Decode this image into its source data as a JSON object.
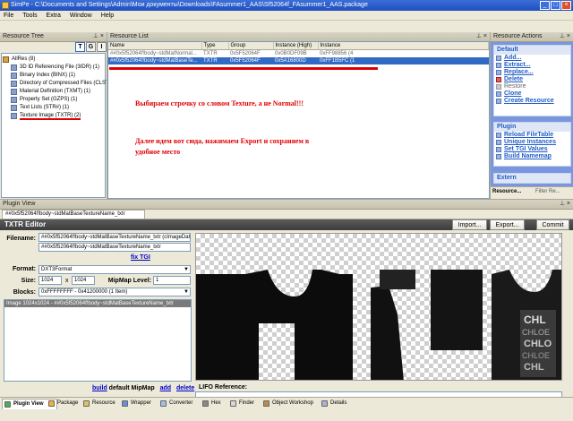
{
  "window": {
    "title": "SimPe - C:\\Documents and Settings\\Admin\\Мои документы\\Downloads\\FAsummer1_AAS\\Sf52064f_FAsummer1_AAS.package"
  },
  "menu": [
    "File",
    "Tools",
    "Extra",
    "Window",
    "Help"
  ],
  "resource_tree": {
    "header": "Resource Tree",
    "items": [
      "AllRes (8)",
      "3D ID Referencing File (3IDR) (1)",
      "Binary Index (BINX) (1)",
      "Directory of Compressed Files (CLST) (1)",
      "Material Definition (TXMT) (1)",
      "Property Set (GZPS) (1)",
      "Text Lists (STR#) (1)",
      "Texture Image (TXTR) (2)"
    ],
    "mode_buttons": [
      "T",
      "G",
      "I"
    ]
  },
  "resource_list": {
    "header": "Resource List",
    "columns": [
      "Name",
      "Type",
      "Group",
      "Instance (High)",
      "Instance"
    ],
    "rows": [
      [
        "##0x5f52064f!body~stdMatNormal...",
        "TXTR",
        "0x5F52064F",
        "0x0B0DF09B",
        "0xFF98856 (4"
      ],
      [
        "##0x5f52064f!body~stdMatBaseTe...",
        "TXTR",
        "0x5F52064F",
        "0x5A16800D",
        "0xFF1B5FC (1"
      ]
    ]
  },
  "annotations": {
    "line1": "Выбираем строчку со словом Texture, а не Normal!!!",
    "line2": "Далее идем вот сюда, нажимаем Export и сохраняем в",
    "line3": "удобное место"
  },
  "resource_actions": {
    "header": "Resource Actions",
    "default_group": {
      "title": "Default",
      "items": [
        "Add...",
        "Extract...",
        "Replace...",
        "Delete",
        "Restore",
        "Clone",
        "Create Resource"
      ]
    },
    "plugin_group": {
      "title": "Plugin",
      "items": [
        "Reload FileTable",
        "Unique Instances",
        "Set TGI Values",
        "Build Namemap"
      ]
    },
    "extern_group": {
      "title": "Extern"
    },
    "bottom_tabs": [
      "Resource...",
      "Filter Re..."
    ]
  },
  "plugin_view": {
    "header": "Plugin View",
    "doc_tab": "##0x5f52064f!body~stdMatBaseTextureName_txtr",
    "editor_title": "TXTR Editor",
    "buttons": {
      "import": "Import...",
      "export": "Export...",
      "commit": "Commit"
    },
    "filename_label": "Filename:",
    "filename_value": "##0x5f52064f!body~stdMatBaseTextureName_txtr (cImageData)",
    "filename_value2": "##0x5f52064f!body~stdMatBaseTextureName_txtr",
    "fix_tgi": "fix TGI",
    "format_label": "Format:",
    "format_value": "DXT3Format",
    "size_label": "Size:",
    "size_w": "1024",
    "size_x": "x",
    "size_h": "1024",
    "mipmap_label": "MipMap Level:",
    "mipmap_value": "1",
    "blocks_label": "Blocks:",
    "blocks_value": "0xFFFFFFFF - 0x41200000 (1 Item)",
    "mip_list_item": "Image 1024x1024 - ##0x5f52064f!body~stdMatBaseTextureName_txtr",
    "mip_links": {
      "build": "build",
      "default": "default MipMap",
      "add": "add",
      "delete": "delete"
    },
    "lifo_label": "LIFO Reference:"
  },
  "bottom_tabs": [
    "Plugin View",
    "Package",
    "Resource",
    "Wrapper",
    "Converter",
    "Hex",
    "Finder",
    "Object Workshop",
    "Details"
  ],
  "colors": {
    "title_bar": "#1f4fbf",
    "selection": "#316ac5",
    "annotation": "#e00000",
    "link": "#215dc6"
  }
}
